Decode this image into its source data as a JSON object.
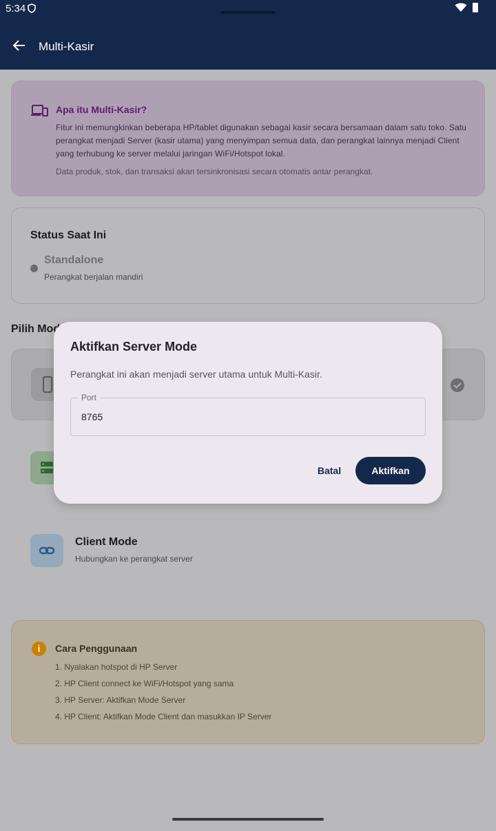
{
  "statusbar": {
    "time": "5:34"
  },
  "appbar": {
    "title": "Multi-Kasir"
  },
  "info": {
    "heading": "Apa itu Multi-Kasir?",
    "body": "Fitur ini memungkinkan beberapa HP/tablet digunakan sebagai kasir secara bersamaan dalam satu toko. Satu perangkat menjadi Server (kasir utama) yang menyimpan semua data, dan perangkat lainnya menjadi Client yang terhubung ke server melalui jaringan WiFi/Hotspot lokal.",
    "note": "Data produk, stok, dan transaksi akan tersinkronisasi secara otomatis antar perangkat."
  },
  "status": {
    "heading": "Status Saat Ini",
    "mode": "Standalone",
    "desc": "Perangkat berjalan mandiri"
  },
  "mode_section": {
    "title_visible": "Pilih Mod"
  },
  "client_mode": {
    "title": "Client Mode",
    "desc": "Hubungkan ke perangkat server"
  },
  "usage": {
    "heading": "Cara Penggunaan",
    "steps": [
      "1. Nyalakan hotspot di HP Server",
      "2. HP Client connect ke WiFi/Hotspot yang sama",
      "3. HP Server: Aktifkan Mode Server",
      "4. HP Client: Aktifkan Mode Client dan masukkan IP Server"
    ]
  },
  "dialog": {
    "title": "Aktifkan Server Mode",
    "message": "Perangkat ini akan menjadi server utama untuk Multi-Kasir.",
    "port_label": "Port",
    "port_value": "8765",
    "cancel_label": "Batal",
    "confirm_label": "Aktifkan"
  },
  "colors": {
    "primary": "#14284b",
    "info_heading": "#5b1e6a",
    "warning_icon": "#c98100"
  }
}
